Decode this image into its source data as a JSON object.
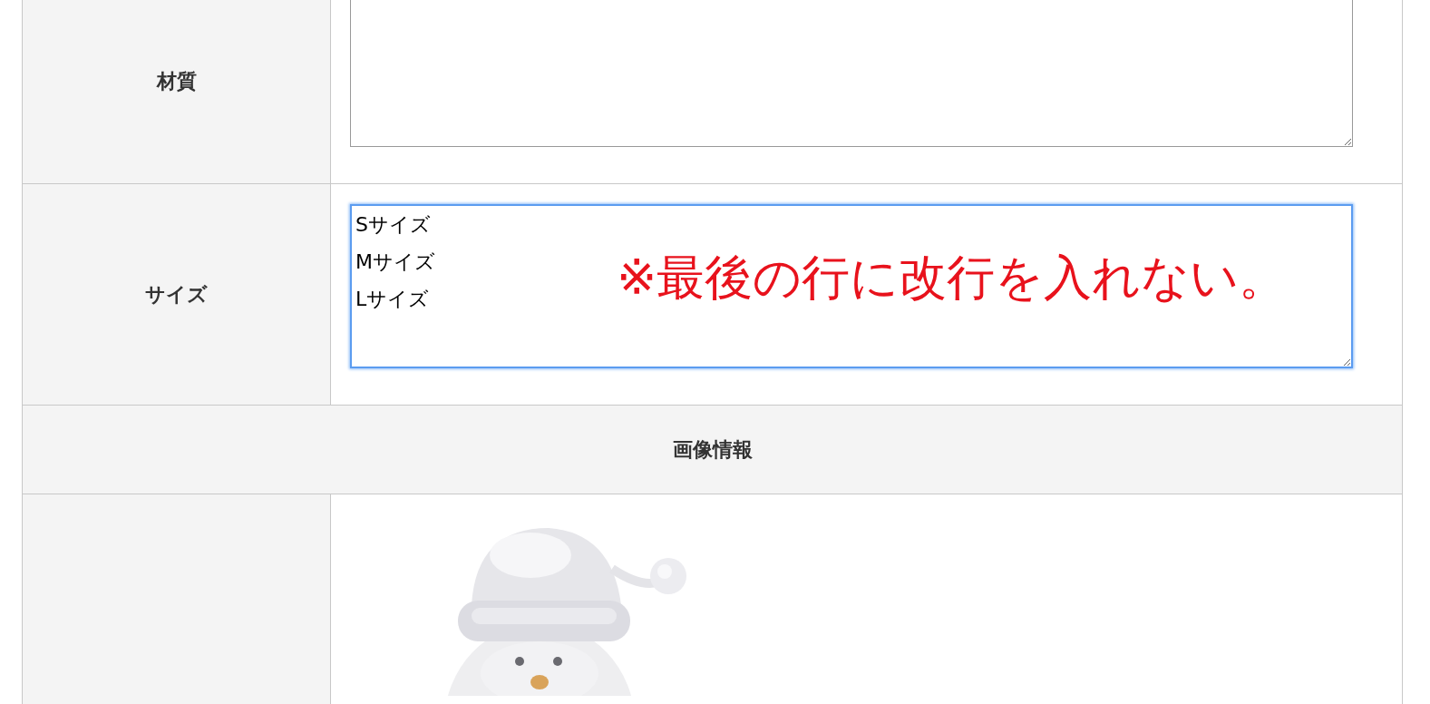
{
  "rows": [
    {
      "kind": "textarea",
      "label": "材質",
      "focused": false
    },
    {
      "kind": "textarea",
      "label": "サイズ",
      "focused": true,
      "value": "Sサイズ\nMサイズ\nLサイズ",
      "note": "※最後の行に改行を入れない。"
    },
    {
      "kind": "section",
      "label": "画像情報"
    },
    {
      "picture": {
        "kind": "picture"
      }
    }
  ]
}
